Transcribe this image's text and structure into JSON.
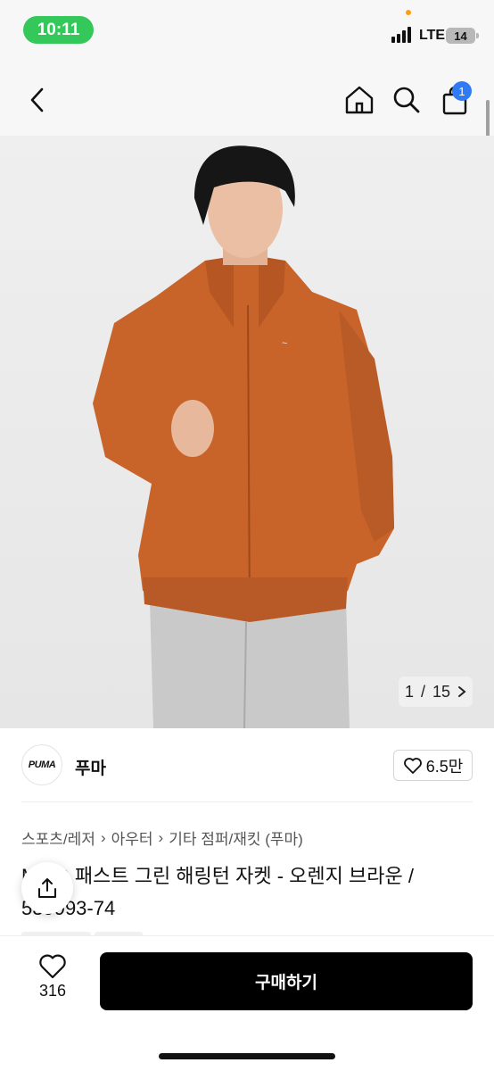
{
  "status_bar": {
    "time": "10:11",
    "network": "LTE",
    "battery": "14"
  },
  "nav": {
    "cart_count": "1"
  },
  "gallery": {
    "current": "1",
    "separator": "/",
    "total": "15"
  },
  "brand": {
    "logo_text": "PUMA",
    "name": "푸마",
    "likes": "6.5만"
  },
  "breadcrumb": [
    "스포츠/레저",
    "아우터",
    "기타 점퍼/재킷 (푸마)"
  ],
  "product": {
    "title": "MMQ 패스트 그린 해링턴 자켓 - 오렌지 브라운 / 539993-74"
  },
  "bottom_bar": {
    "wish_count": "316",
    "buy_label": "구매하기"
  },
  "colors": {
    "status_pill": "#34c759",
    "cart_badge": "#2f7bf5",
    "jacket": "#c8632a",
    "buy_button": "#000000"
  }
}
